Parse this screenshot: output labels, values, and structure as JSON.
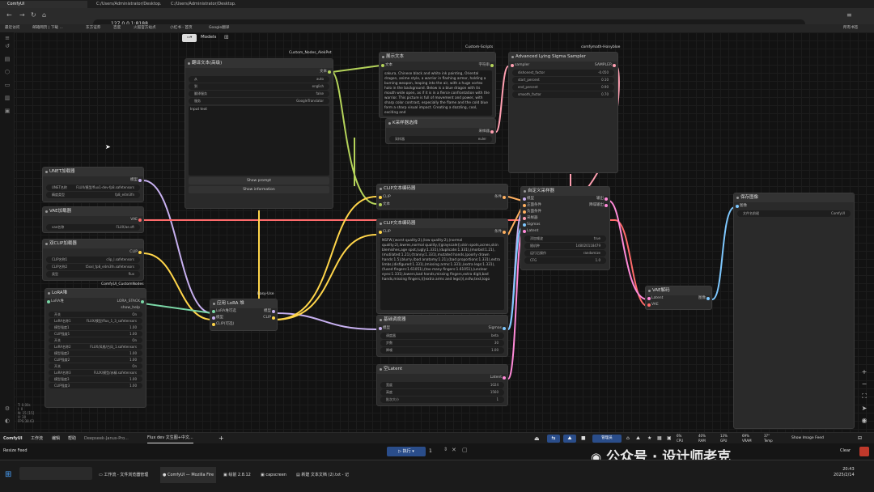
{
  "browser": {
    "tabs": [
      "ComfyUI",
      "C:/Users/Administrator/Desktop...",
      "C:/Users/Administrator/Desktop..."
    ],
    "url": "127.0.0.1:8188",
    "bookmarks": [
      "最近访问",
      "邮箱网页 | 下载 ...",
      "东方证券",
      "百度",
      "火狐官方站点",
      "小红书 - 首页",
      "Google翻译",
      "所有书签"
    ]
  },
  "toolbar": {
    "models_label": "Models"
  },
  "packs": {
    "custom_nodes": "Custom_Nodes_AlekPet",
    "custom_scripts": "Custom-Scripts",
    "comfy_mtb": "comfymath-Honybloe",
    "easy_use": "Easy-Use",
    "comfyui_custom": "ComfyUI_CustomNodes"
  },
  "nodes": {
    "translate": {
      "title": "翻译文本(高级)",
      "output": "文本",
      "rows": [
        [
          "从",
          "auto"
        ],
        [
          "到",
          "english"
        ],
        [
          "翻译服务",
          "false"
        ],
        [
          "服务",
          "GoogleTranslator"
        ]
      ],
      "placeholder": "Input text",
      "btn1": "Show prompt",
      "btn2": "Show information"
    },
    "show_text": {
      "title": "展示文本",
      "input": "文本",
      "output": "字符串",
      "content": "sakura, Chinese black and white ink painting, Oriental dragon, anime style, a warrior in flashing armor, holding a burning weapon, leaping into the air, with a huge vortex halo in the background. Below is a blue dragon with its mouth wide open, as if it is in a fierce confrontation with the warrior. This picture is full of movement and power, with sharp color contrast, especially the flame and the cold blue form a sharp visual impact. Creating a dazzling, cool, exciting and"
    },
    "sampler_select": {
      "title": "K采样器选择",
      "output": "采样器",
      "row": [
        "采样器",
        "euler"
      ]
    },
    "sigma": {
      "title": "Advanced Lying Sigma Sampler",
      "input": "sampler",
      "output": "SAMPLER",
      "rows": [
        [
          "dishonest_factor",
          "-0.050"
        ],
        [
          "start_percent",
          "0.10"
        ],
        [
          "end_percent",
          "0.90"
        ],
        [
          "smooth_factor",
          "0.70"
        ]
      ]
    },
    "unet": {
      "title": "UNET加载器",
      "output": "模型",
      "rows": [
        [
          "UNET名称",
          "FLUX/模型/flux1-dev-fp8.safetensors"
        ],
        [
          "精度类型",
          "fp8_e4m3fn"
        ]
      ]
    },
    "vae": {
      "title": "VAE加载器",
      "output": "VAE",
      "row": [
        "vae名称",
        "FLUX/ae.sft"
      ]
    },
    "dual_clip": {
      "title": "双CLIP加载器",
      "output": "CLIP",
      "rows": [
        [
          "CLIP名称1",
          "clip_l.safetensors"
        ],
        [
          "CLIP名称2",
          "t5xxl_fp8_e4m3fn.safetensors"
        ],
        [
          "类型",
          "flux"
        ]
      ]
    },
    "lora_stack": {
      "title": "LoRA堆",
      "in": "LoRA堆",
      "out1": "LORA_STACK",
      "out2": "show_help",
      "rows": [
        [
          "开关",
          "On"
        ],
        [
          "LoRA名称1",
          "FLUX/模型/flux_1_3_safetensors"
        ],
        [
          "模型强度1",
          "1.00"
        ],
        [
          "CLIP强度1",
          "1.00"
        ],
        [
          "开关",
          "On"
        ],
        [
          "LoRA名称2",
          "FLUX/风格/古风_1.safetensors"
        ],
        [
          "模型强度2",
          "1.00"
        ],
        [
          "CLIP强度2",
          "1.00"
        ],
        [
          "开关",
          "On"
        ],
        [
          "LoRA名称3",
          "FLUX/模型/赤精.safetensors"
        ],
        [
          "模型强度3",
          "1.00"
        ],
        [
          "CLIP强度3",
          "1.00"
        ]
      ]
    },
    "apply_lora": {
      "title": "应用 LoRA 堆",
      "inputs": [
        "LoRA堆可选",
        "模型",
        "CLIP(可选)"
      ],
      "outputs": [
        "模型",
        "CLIP"
      ]
    },
    "clip_pos": {
      "title": "CLIP文本编码器",
      "inputs": [
        "CLIP",
        "文本"
      ],
      "output": "条件"
    },
    "clip_neg": {
      "title": "CLIP文本编码器",
      "input": "CLIP",
      "output": "条件",
      "content": "NSFW,(worst quality:2),(low quality:2),(normal quality:2),lowres,normal quality,((grayscale)),skin spots,acnes,skin blemishes,age spot,(ugly:1.331),(duplicate:1.331),(morbid:1.21),(mutilated:1.21),(tranny:1.331),mutated hands,(poorly drawn hands:1.5),blurry,(bad anatomy:1.21),(bad proportions:1.331),extra limbs,(disfigured:1.331),(missing arms:1.331),(extra legs:1.331),(fused fingers:1.61051),(too many fingers:1.61051),(unclear eyes:1.331),lowers,bad hands,missing fingers,extra digit,bad hands,missing fingers,(((extra arms and legs))),nsfw,text,logo"
    },
    "basic_sched": {
      "title": "基础调度器",
      "input": "模型",
      "output": "Sigmas",
      "rows": [
        [
          "调度器",
          "beta"
        ],
        [
          "步数",
          "30"
        ],
        [
          "降噪",
          "1.00"
        ]
      ]
    },
    "latent": {
      "title": "空Latent",
      "output": "Latent",
      "rows": [
        [
          "宽度",
          "1024"
        ],
        [
          "高度",
          "1560"
        ],
        [
          "批次大小",
          "1"
        ]
      ]
    },
    "custom_sampler": {
      "title": "自定义采样器",
      "inputs": [
        "模型",
        "正面条件",
        "负面条件",
        "采样器",
        "Sigmas",
        "Latent"
      ],
      "outputs": [
        "输出",
        "降噪输出"
      ],
      "rows": [
        [
          "添加噪波",
          "true"
        ],
        [
          "随机种",
          "148020118479"
        ],
        [
          "运行后操作",
          "randomize"
        ],
        [
          "CFG",
          "1.0"
        ]
      ]
    },
    "vae_decode": {
      "title": "VAE解码",
      "inputs": [
        "Latent",
        "VAE"
      ],
      "output": "图像"
    },
    "save": {
      "title": "保存图像",
      "input": "图像",
      "row": [
        "文件名前缀",
        "ComfyUI"
      ]
    }
  },
  "info": [
    "T: 0.00s",
    "I: 0",
    "N: 15 [15]",
    "V: 30",
    "FPS:38.63"
  ],
  "bottom": {
    "app": "ComfyUI",
    "menus": [
      "工作流",
      "编辑",
      "帮助"
    ],
    "tabs": [
      "Deepseek-Janus-Pro...",
      "Flux dev 文生图+中文..."
    ],
    "queue": "管理员",
    "show_feed": "Show Image Feed",
    "resize_feed": "Resize Feed",
    "run": "执行",
    "batch": "1",
    "clear": "Clear"
  },
  "stats": [
    [
      "CPU",
      "6%"
    ],
    [
      "RAM",
      "40%"
    ],
    [
      "GPU",
      "13%"
    ],
    [
      "VRAM",
      "69%"
    ],
    [
      "Temp",
      "37°"
    ]
  ],
  "watermark": "公众号 · 设计师老克",
  "taskbar": {
    "items": [
      "工作流 - 文件浏览器管理",
      "ComfyUI — Mozilla Fire",
      "绘前 2.8.12",
      "capscreen",
      "新建 文本文档 (2).txt - 记"
    ],
    "time": "20:43",
    "date": "2025/2/14"
  }
}
